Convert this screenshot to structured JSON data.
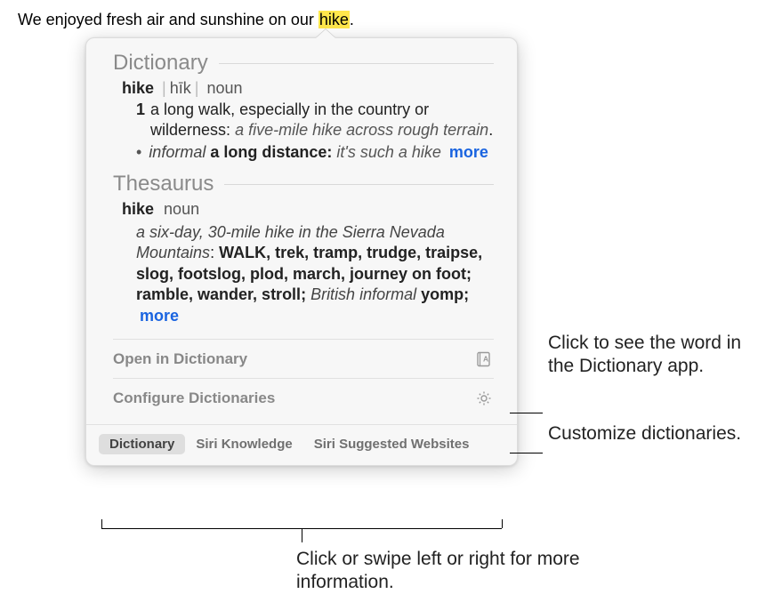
{
  "context": {
    "before": "We enjoyed fresh air and sunshine on our ",
    "highlight": "hike",
    "after": "."
  },
  "dictionary": {
    "title": "Dictionary",
    "word": "hike",
    "pronunciation": "hīk",
    "part_of_speech": "noun",
    "sense_number": "1",
    "definition": "a long walk, especially in the country or wilderness: ",
    "example": "a five-mile hike across rough terrain",
    "sub_tag": "informal",
    "sub_def": "a long distance: ",
    "sub_example": "it's such a hike",
    "more": "more"
  },
  "thesaurus": {
    "title": "Thesaurus",
    "word": "hike",
    "part_of_speech": "noun",
    "example": "a six-day, 30-mile hike in the Sierra Nevada Mountains",
    "lead_word": "WALK",
    "synonyms": ", trek, tramp, trudge, traipse, slog, footslog, plod, march, journey on foot; ramble, wander, stroll; ",
    "regional_tag": "British informal",
    "regional_word": " yomp; ",
    "more": "more"
  },
  "menu": {
    "open": "Open in Dictionary",
    "configure": "Configure Dictionaries"
  },
  "tabs": {
    "dictionary": "Dictionary",
    "siri_knowledge": "Siri Knowledge",
    "siri_websites": "Siri Suggested Websites"
  },
  "callouts": {
    "open": "Click to see the word in the Dictionary app.",
    "configure": "Customize dictionaries.",
    "tabs": "Click or swipe left or right for more information."
  }
}
